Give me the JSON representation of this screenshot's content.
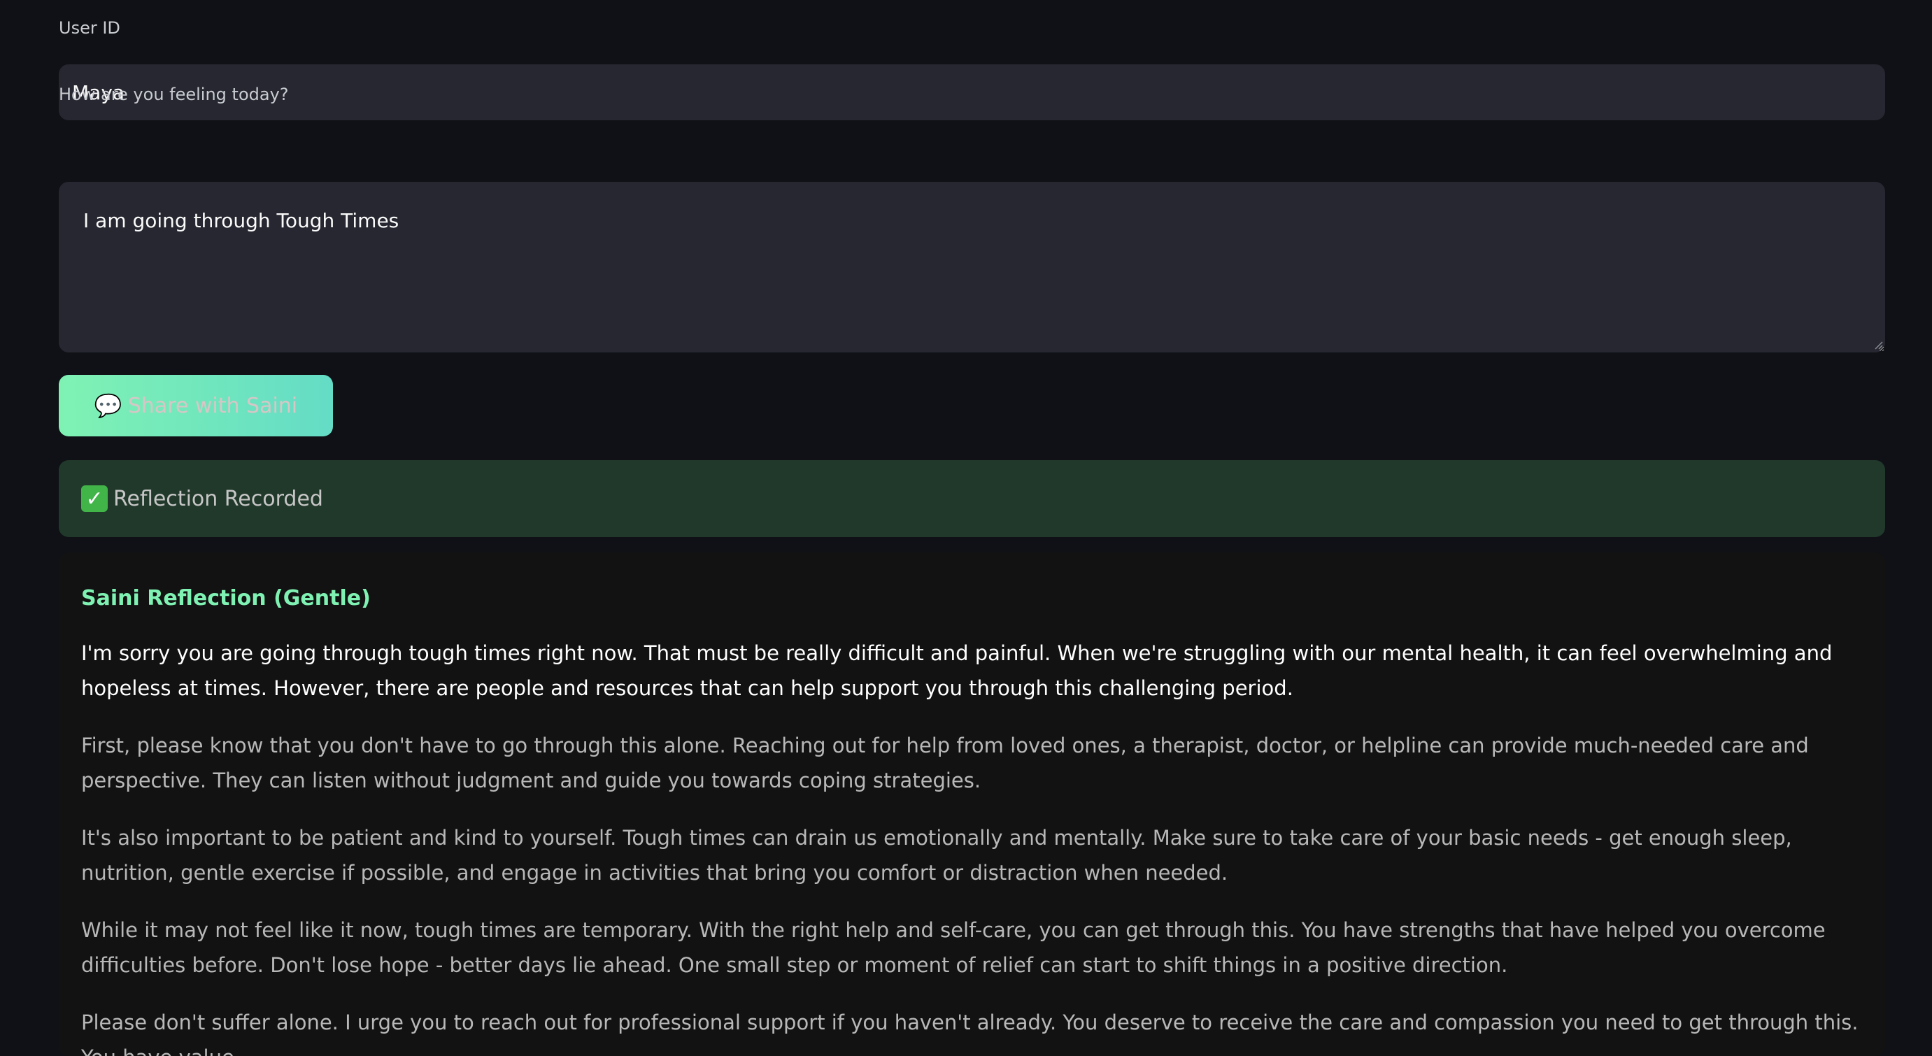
{
  "form": {
    "user_id_label": "User ID",
    "user_id_value": "Maya",
    "feeling_label": "How are you feeling today?",
    "feeling_value": "I am going through Tough Times",
    "share_button_icon": "speech-bubble-icon",
    "share_button_label": "Share with Saini"
  },
  "status": {
    "icon": "check-mark-icon",
    "message": "Reflection Recorded"
  },
  "reflection": {
    "title": "Saini Reflection (Gentle)",
    "paragraphs": [
      "I'm sorry you are going through tough times right now. That must be really difficult and painful. When we're struggling with our mental health, it can feel overwhelming and hopeless at times. However, there are people and resources that can help support you through this challenging period.",
      "First, please know that you don't have to go through this alone. Reaching out for help from loved ones, a therapist, doctor, or helpline can provide much-needed care and perspective. They can listen without judgment and guide you towards coping strategies.",
      "It's also important to be patient and kind to yourself. Tough times can drain us emotionally and mentally. Make sure to take care of your basic needs - get enough sleep, nutrition, gentle exercise if possible, and engage in activities that bring you comfort or distraction when needed.",
      "While it may not feel like it now, tough times are temporary. With the right help and self-care, you can get through this. You have strengths that have helped you overcome difficulties before. Don't lose hope - better days lie ahead. One small step or moment of relief can start to shift things in a positive direction.",
      "Please don't suffer alone. I urge you to reach out for professional support if you haven't already. You deserve to receive the care and compassion you need to get through this. You have value."
    ]
  },
  "colors": {
    "background": "#0f1116",
    "input_bg": "#262730",
    "accent": "#7ff2b3",
    "success_bg": "#21392b"
  }
}
